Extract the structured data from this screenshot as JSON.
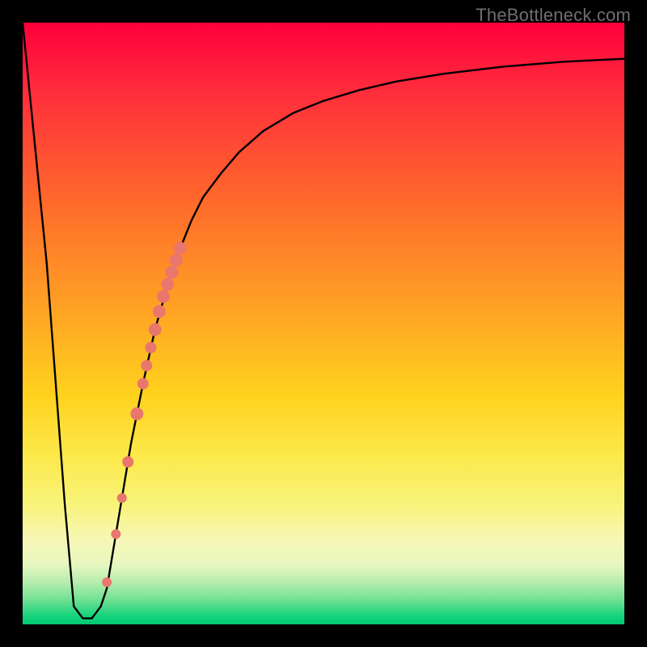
{
  "watermark": "TheBottleneck.com",
  "chart_data": {
    "type": "line",
    "title": "",
    "xlabel": "",
    "ylabel": "",
    "xlim": [
      0,
      100
    ],
    "ylim": [
      0,
      100
    ],
    "grid": false,
    "series": [
      {
        "name": "bottleneck-curve",
        "color": "#000000",
        "x": [
          0,
          4,
          7,
          8.5,
          10,
          11.5,
          13,
          14,
          16,
          18,
          20,
          22,
          24,
          26,
          28,
          30,
          33,
          36,
          40,
          45,
          50,
          56,
          62,
          70,
          80,
          90,
          100
        ],
        "y": [
          100,
          60,
          20,
          3,
          1,
          1,
          3,
          6,
          18,
          30,
          40,
          49,
          56,
          62,
          67,
          71,
          75,
          78.5,
          82,
          85,
          87,
          88.8,
          90.2,
          91.5,
          92.7,
          93.5,
          94
        ]
      }
    ],
    "highlight_points": {
      "name": "highlight-dots",
      "color": "#e9776d",
      "points": [
        {
          "x": 17.5,
          "y": 27,
          "r": 7
        },
        {
          "x": 19.0,
          "y": 35,
          "r": 8
        },
        {
          "x": 20.0,
          "y": 40,
          "r": 7
        },
        {
          "x": 20.6,
          "y": 43,
          "r": 7
        },
        {
          "x": 21.3,
          "y": 46,
          "r": 7
        },
        {
          "x": 22.0,
          "y": 49,
          "r": 8
        },
        {
          "x": 22.7,
          "y": 52,
          "r": 8
        },
        {
          "x": 23.4,
          "y": 54.5,
          "r": 8
        },
        {
          "x": 24.1,
          "y": 56.5,
          "r": 8
        },
        {
          "x": 24.8,
          "y": 58.5,
          "r": 8
        },
        {
          "x": 25.5,
          "y": 60.5,
          "r": 8
        },
        {
          "x": 26.2,
          "y": 62.5,
          "r": 8
        },
        {
          "x": 15.5,
          "y": 15,
          "r": 6
        },
        {
          "x": 14.0,
          "y": 7,
          "r": 6
        },
        {
          "x": 16.5,
          "y": 21,
          "r": 6
        }
      ]
    },
    "gradient_stops": [
      {
        "pos": 0.0,
        "color": "#ff003b"
      },
      {
        "pos": 0.12,
        "color": "#ff2f3b"
      },
      {
        "pos": 0.3,
        "color": "#ff6a2b"
      },
      {
        "pos": 0.48,
        "color": "#ffa423"
      },
      {
        "pos": 0.62,
        "color": "#ffd21e"
      },
      {
        "pos": 0.72,
        "color": "#fce94a"
      },
      {
        "pos": 0.8,
        "color": "#f8f379"
      },
      {
        "pos": 0.86,
        "color": "#f7f7b6"
      },
      {
        "pos": 0.9,
        "color": "#e8f7c0"
      },
      {
        "pos": 0.93,
        "color": "#b7edae"
      },
      {
        "pos": 0.96,
        "color": "#6fe093"
      },
      {
        "pos": 0.985,
        "color": "#19d37d"
      },
      {
        "pos": 1.0,
        "color": "#00c96f"
      }
    ]
  }
}
